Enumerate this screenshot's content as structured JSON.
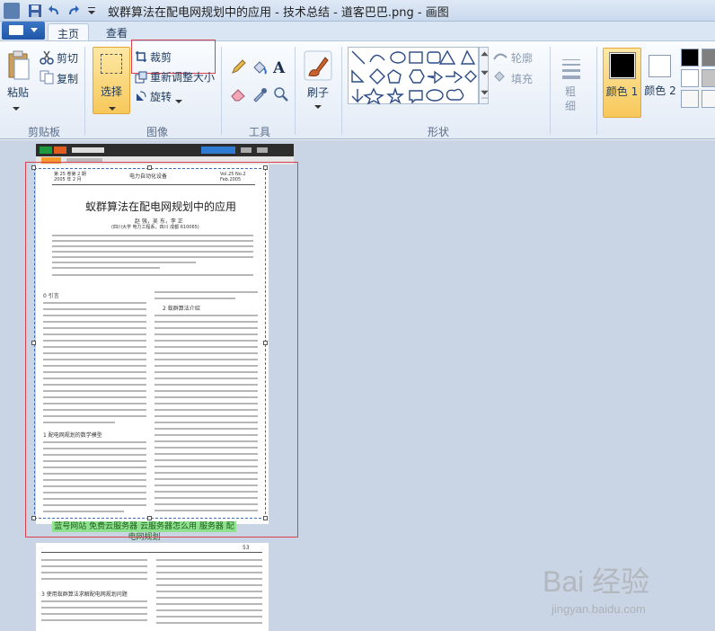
{
  "window": {
    "title": "蚁群算法在配电网规划中的应用 - 技术总结 - 道客巴巴.png - 画图"
  },
  "tabs": [
    {
      "label": "主页",
      "active": true
    },
    {
      "label": "查看",
      "active": false
    }
  ],
  "clipboard": {
    "paste_label": "粘贴",
    "cut_label": "剪切",
    "copy_label": "复制",
    "group_label": "剪贴板"
  },
  "image": {
    "select_label": "选择",
    "crop_label": "裁剪",
    "resize_label": "重新调整大小",
    "rotate_label": "旋转",
    "group_label": "图像"
  },
  "tools": {
    "group_label": "工具"
  },
  "brushes": {
    "label": "刷子"
  },
  "shapes": {
    "outline_label": "轮廓",
    "fill_label": "填充",
    "group_label": "形状"
  },
  "size": {
    "label": "粗细"
  },
  "colors": {
    "color1_label": "颜色 1",
    "color2_label": "颜色 2",
    "color1": "#000000",
    "color2": "#ffffff"
  },
  "document": {
    "journal_left": "第 25 卷第 2 期\n2005 年 2 月",
    "journal_center": "电力自动化设备",
    "journal_right": "Vol.25 No.2\nFeb.2005",
    "title": "蚁群算法在配电网规划中的应用",
    "authors": "赵 强，吴 东，李 正",
    "affiliation": "(四川大学 电力工程系，四川 成都 610065)",
    "section0": "0 引言",
    "section1": "1 配电网规划的数学模型",
    "section2": "2 蚁群算法介绍",
    "banner": "蓝号网站 免费云服务器 云服务器怎么用 服务器 配电网规划",
    "page2_section": "3 使用蚁群算法求解配电网规划问题",
    "page_number": "53"
  },
  "watermark": {
    "text": "Bai 经验",
    "subtext": "jingyan.baidu.com"
  }
}
